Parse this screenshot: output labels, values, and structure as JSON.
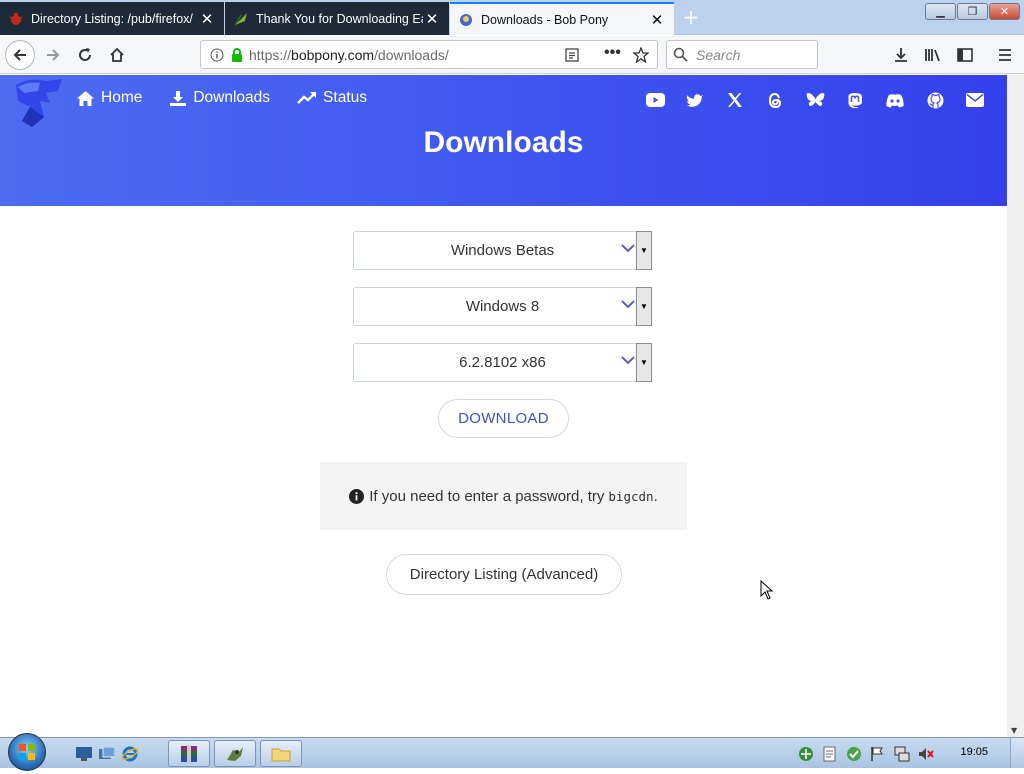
{
  "browser": {
    "tabs": [
      {
        "title": "Directory Listing: /pub/firefox/",
        "active": false
      },
      {
        "title": "Thank You for Downloading Ea",
        "active": false
      },
      {
        "title": "Downloads - Bob Pony",
        "active": true
      }
    ],
    "url_prefix": "https://",
    "url_host": "bobpony.com",
    "url_path": "/downloads/",
    "search_placeholder": "Search"
  },
  "site": {
    "nav": [
      {
        "label": "Home",
        "icon": "home-icon"
      },
      {
        "label": "Downloads",
        "icon": "download-icon"
      },
      {
        "label": "Status",
        "icon": "trending-up-icon"
      }
    ],
    "social_icons": [
      "youtube-icon",
      "twitter-icon",
      "x-icon",
      "threads-icon",
      "bluesky-icon",
      "mastodon-icon",
      "discord-icon",
      "github-icon",
      "email-icon"
    ],
    "heading": "Downloads",
    "hero_color": "#4355f0"
  },
  "form": {
    "category": "Windows Betas",
    "version": "Windows 8",
    "build": "6.2.8102 x86",
    "download_label": "DOWNLOAD",
    "notice_text": "If you need to enter a password, try",
    "password": "bigcdn",
    "notice_end": ".",
    "directory_label": "Directory Listing (Advanced)"
  },
  "taskbar": {
    "clock": "19:05"
  }
}
